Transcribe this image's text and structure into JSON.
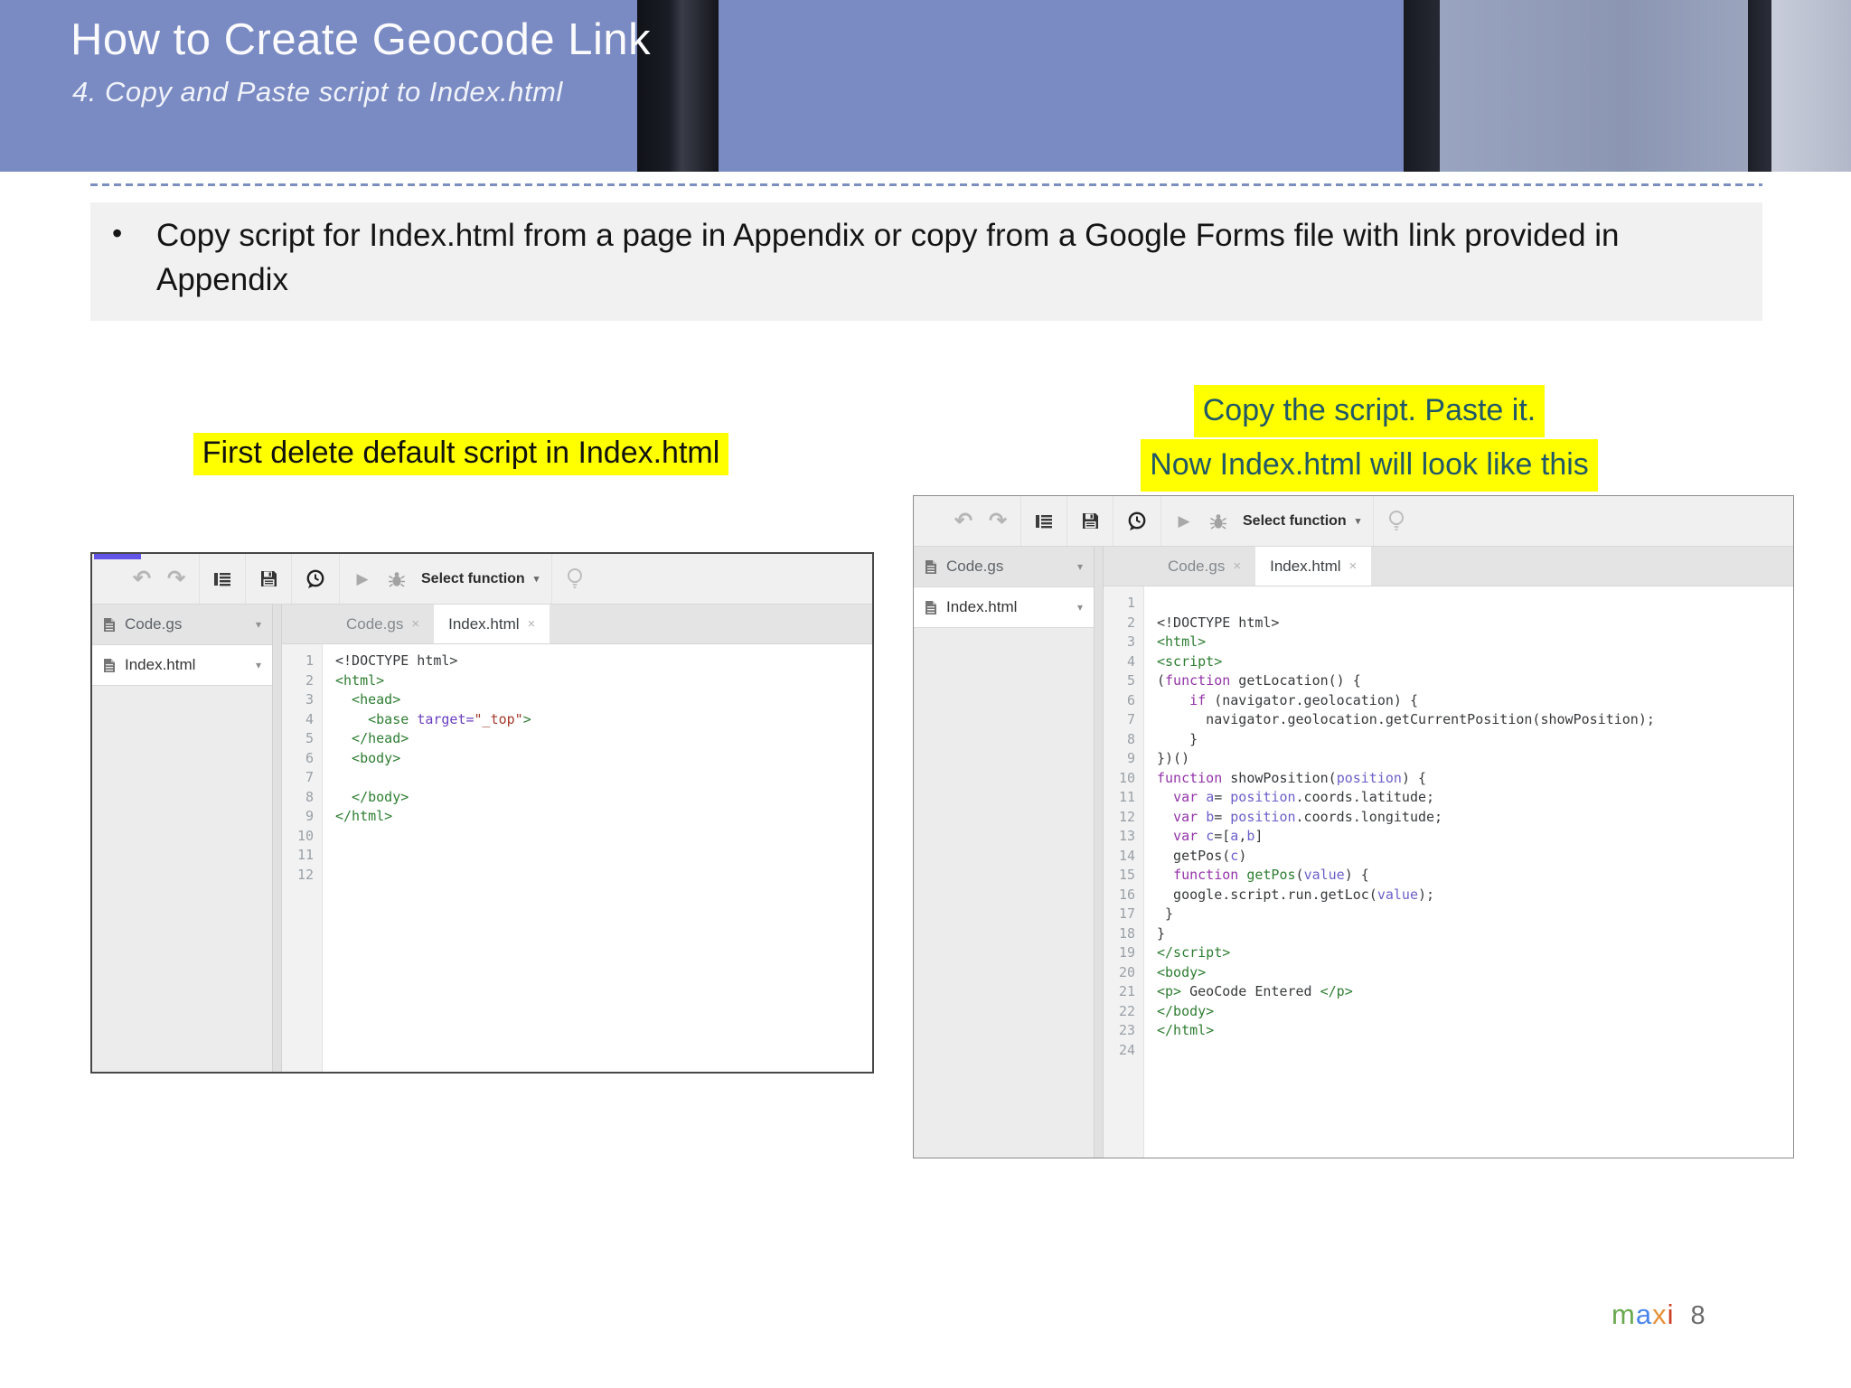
{
  "slide": {
    "title": "How to Create Geocode Link",
    "subtitle": "4. Copy and Paste script to Index.html",
    "bullet": {
      "marker": "•",
      "text": "Copy script for Index.html from a page in Appendix or copy from a Google Forms file with link provided in Appendix"
    },
    "captions": {
      "left": "First delete default script in Index.html",
      "right_line1": "Copy the script. Paste it.",
      "right_line2": "Now Index.html will look like this"
    },
    "footer": {
      "logo_letters": [
        {
          "ch": "m",
          "color": "#6aa84f"
        },
        {
          "ch": "a",
          "color": "#4a86e8"
        },
        {
          "ch": "x",
          "color": "#e69138"
        },
        {
          "ch": "i",
          "color": "#cc4125"
        }
      ],
      "page_number": "8"
    },
    "colors": {
      "header_bg": "#7a8ac2",
      "highlight_yellow": "#ffff00",
      "caption_right_text": "#215868",
      "bullet_box_bg": "#f1f1f1",
      "progress_bar": "#6254e8"
    }
  },
  "icons": {
    "undo": "↶",
    "redo": "↷",
    "play": "▶",
    "caret": "▾",
    "close": "×"
  },
  "editor_left": {
    "toolbar": {
      "select_function": "Select function"
    },
    "sidebar": [
      {
        "label": "Code.gs"
      },
      {
        "label": "Index.html"
      }
    ],
    "tabs": [
      {
        "label": "Code.gs"
      },
      {
        "label": "Index.html"
      }
    ],
    "line_count": 12,
    "code": [
      [
        [
          "plain",
          "<!DOCTYPE html>"
        ]
      ],
      [
        [
          "tag",
          "<html>"
        ]
      ],
      [
        [
          "tag",
          "  <head>"
        ]
      ],
      [
        [
          "tag",
          "    <base "
        ],
        [
          "attr",
          "target="
        ],
        [
          "str",
          "\"_top\""
        ],
        [
          "tag",
          ">"
        ]
      ],
      [
        [
          "tag",
          "  </head>"
        ]
      ],
      [
        [
          "tag",
          "  <body>"
        ]
      ],
      [],
      [
        [
          "tag",
          "  </body>"
        ]
      ],
      [
        [
          "tag",
          "</html>"
        ]
      ],
      [],
      [],
      []
    ]
  },
  "editor_right": {
    "toolbar": {
      "select_function": "Select function"
    },
    "sidebar": [
      {
        "label": "Code.gs"
      },
      {
        "label": "Index.html"
      }
    ],
    "tabs": [
      {
        "label": "Code.gs"
      },
      {
        "label": "Index.html"
      }
    ],
    "line_count": 24,
    "code": [
      [],
      [
        [
          "plain",
          "<!DOCTYPE html>"
        ]
      ],
      [
        [
          "tag",
          "<html>"
        ]
      ],
      [
        [
          "tag",
          "<script>"
        ]
      ],
      [
        [
          "plain",
          "("
        ],
        [
          "kw",
          "function"
        ],
        [
          "plain",
          " getLocation() {"
        ]
      ],
      [
        [
          "plain",
          "    "
        ],
        [
          "kw",
          "if"
        ],
        [
          "plain",
          " (navigator.geolocation) {"
        ]
      ],
      [
        [
          "plain",
          "      navigator.geolocation.getCurrentPosition(showPosition);"
        ]
      ],
      [
        [
          "plain",
          "    }"
        ]
      ],
      [
        [
          "plain",
          "})()"
        ]
      ],
      [
        [
          "kw",
          "function"
        ],
        [
          "plain",
          " showPosition("
        ],
        [
          "var",
          "position"
        ],
        [
          "plain",
          ") {"
        ]
      ],
      [
        [
          "plain",
          "  "
        ],
        [
          "kw",
          "var"
        ],
        [
          "plain",
          " "
        ],
        [
          "var",
          "a"
        ],
        [
          "plain",
          "= "
        ],
        [
          "var",
          "position"
        ],
        [
          "plain",
          ".coords.latitude;"
        ]
      ],
      [
        [
          "plain",
          "  "
        ],
        [
          "kw",
          "var"
        ],
        [
          "plain",
          " "
        ],
        [
          "var",
          "b"
        ],
        [
          "plain",
          "= "
        ],
        [
          "var",
          "position"
        ],
        [
          "plain",
          ".coords.longitude;"
        ]
      ],
      [
        [
          "plain",
          "  "
        ],
        [
          "kw",
          "var"
        ],
        [
          "plain",
          " "
        ],
        [
          "var",
          "c"
        ],
        [
          "plain",
          "=["
        ],
        [
          "var",
          "a"
        ],
        [
          "plain",
          ","
        ],
        [
          "var",
          "b"
        ],
        [
          "plain",
          "]"
        ]
      ],
      [
        [
          "plain",
          "  getPos("
        ],
        [
          "var",
          "c"
        ],
        [
          "plain",
          ")"
        ]
      ],
      [
        [
          "plain",
          "  "
        ],
        [
          "kw",
          "function"
        ],
        [
          "plain",
          " "
        ],
        [
          "fn",
          "getPos"
        ],
        [
          "plain",
          "("
        ],
        [
          "var",
          "value"
        ],
        [
          "plain",
          ") {"
        ]
      ],
      [
        [
          "plain",
          "  google.script.run.getLoc("
        ],
        [
          "var",
          "value"
        ],
        [
          "plain",
          ");"
        ]
      ],
      [
        [
          "plain",
          " }"
        ]
      ],
      [
        [
          "plain",
          "}"
        ]
      ],
      [
        [
          "tag",
          "</script>"
        ]
      ],
      [
        [
          "tag",
          "<body>"
        ]
      ],
      [
        [
          "tag",
          "<p>"
        ],
        [
          "plain",
          " GeoCode Entered "
        ],
        [
          "tag",
          "</p>"
        ]
      ],
      [
        [
          "tag",
          "</body>"
        ]
      ],
      [
        [
          "tag",
          "</html>"
        ]
      ],
      []
    ]
  }
}
